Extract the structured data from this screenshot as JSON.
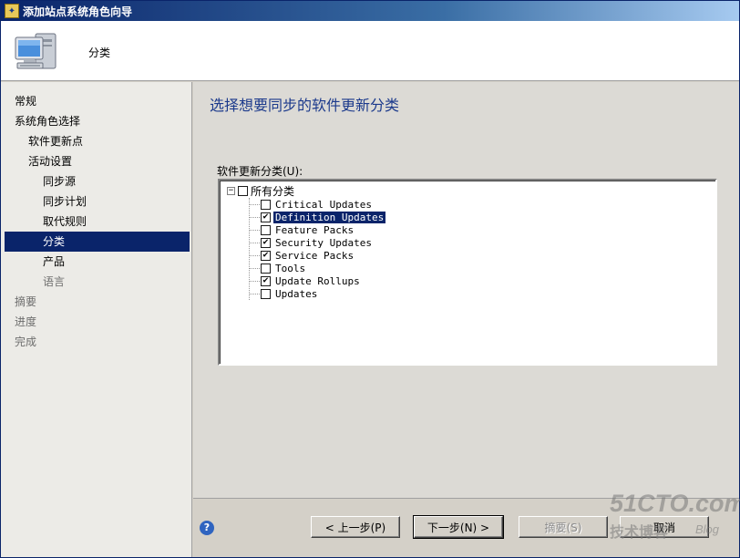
{
  "window": {
    "title": "添加站点系统角色向导"
  },
  "header": {
    "title": "分类"
  },
  "sidebar": {
    "items": [
      {
        "label": "常规",
        "state": "normal"
      },
      {
        "label": "系统角色选择",
        "state": "normal"
      },
      {
        "label": "软件更新点",
        "state": "normal"
      },
      {
        "label": "活动设置",
        "state": "normal"
      },
      {
        "label": "同步源",
        "state": "normal"
      },
      {
        "label": "同步计划",
        "state": "normal"
      },
      {
        "label": "取代规则",
        "state": "normal"
      },
      {
        "label": "分类",
        "state": "active"
      },
      {
        "label": "产品",
        "state": "normal"
      },
      {
        "label": "语言",
        "state": "dim"
      },
      {
        "label": "摘要",
        "state": "dim"
      },
      {
        "label": "进度",
        "state": "dim"
      },
      {
        "label": "完成",
        "state": "dim"
      }
    ]
  },
  "main": {
    "heading": "选择想要同步的软件更新分类",
    "tree_label": "软件更新分类(U):",
    "tree": {
      "root": {
        "label": "所有分类",
        "checked": false,
        "expander": "−"
      },
      "items": [
        {
          "label": "Critical Updates",
          "checked": false,
          "selected": false
        },
        {
          "label": "Definition Updates",
          "checked": true,
          "selected": true
        },
        {
          "label": "Feature Packs",
          "checked": false,
          "selected": false
        },
        {
          "label": "Security Updates",
          "checked": true,
          "selected": false
        },
        {
          "label": "Service Packs",
          "checked": true,
          "selected": false
        },
        {
          "label": "Tools",
          "checked": false,
          "selected": false
        },
        {
          "label": "Update Rollups",
          "checked": true,
          "selected": false
        },
        {
          "label": "Updates",
          "checked": false,
          "selected": false
        }
      ]
    }
  },
  "footer": {
    "help_glyph": "?",
    "back_label": "< 上一步(P)",
    "next_label": "下一步(N) >",
    "summary_label": "摘要(S)",
    "cancel_label": "取消"
  },
  "watermark": {
    "main": "51CTO.com",
    "sub": "技术博客",
    "blog": "Blog"
  },
  "colors": {
    "title_bar": "#0a246a",
    "selection": "#0a246a",
    "heading": "#1c3a8c"
  }
}
